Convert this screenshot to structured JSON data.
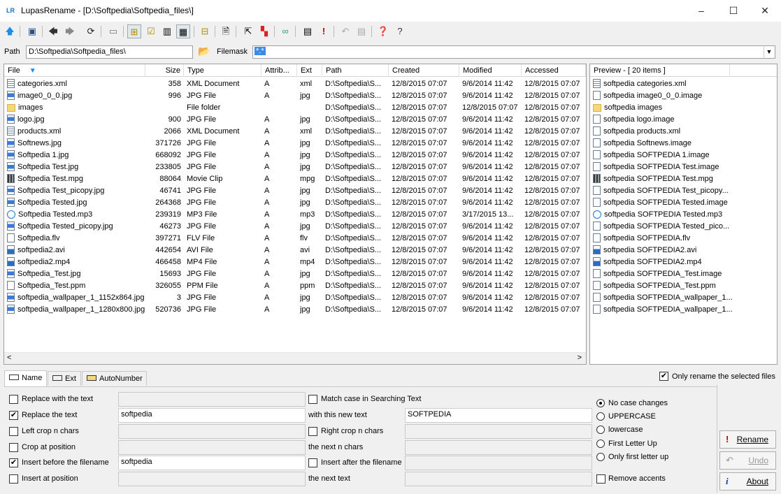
{
  "window": {
    "app_icon": "LR",
    "title": "LupasRename - [D:\\Softpedia\\Softpedia_files\\]",
    "minimize": "–",
    "maximize": "☐",
    "close": "✕"
  },
  "toolbar": {
    "icons": [
      "up-arrow-icon",
      "panel-icon",
      "back-icon",
      "forward-icon",
      "refresh-icon",
      "eraser-icon",
      "tree-icon",
      "check-list-icon",
      "columns-icon",
      "grid-icon",
      "folder-tree-icon",
      "document-icon",
      "export-icon",
      "color-icon",
      "glasses-icon",
      "batch-icon",
      "exclamation-icon",
      "undo-icon",
      "undo-batch-icon",
      "help-book-icon",
      "question-icon"
    ]
  },
  "pathbar": {
    "path_label": "Path",
    "path_value": "D:\\Softpedia\\Softpedia_files\\",
    "filemask_label": "Filemask",
    "filemask_value": "*.*"
  },
  "filelist": {
    "columns": [
      "File",
      "Size",
      "Type",
      "Attrib...",
      "Ext",
      "Path",
      "Created",
      "Modified",
      "Accessed"
    ],
    "rows": [
      {
        "icon": "xml",
        "name": "categories.xml",
        "size": "358",
        "type": "XML Document",
        "attrib": "A",
        "ext": "xml",
        "path": "D:\\Softpedia\\S...",
        "created": "12/8/2015 07:07",
        "modified": "9/6/2014 11:42",
        "accessed": "12/8/2015 07:07"
      },
      {
        "icon": "img",
        "name": "image0_0_0.jpg",
        "size": "996",
        "type": "JPG File",
        "attrib": "A",
        "ext": "jpg",
        "path": "D:\\Softpedia\\S...",
        "created": "12/8/2015 07:07",
        "modified": "9/6/2014 11:42",
        "accessed": "12/8/2015 07:07"
      },
      {
        "icon": "folder",
        "name": "images",
        "size": "",
        "type": "File folder",
        "attrib": "",
        "ext": "",
        "path": "D:\\Softpedia\\S...",
        "created": "12/8/2015 07:07",
        "modified": "12/8/2015 07:07",
        "accessed": "12/8/2015 07:07"
      },
      {
        "icon": "img",
        "name": "logo.jpg",
        "size": "900",
        "type": "JPG File",
        "attrib": "A",
        "ext": "jpg",
        "path": "D:\\Softpedia\\S...",
        "created": "12/8/2015 07:07",
        "modified": "9/6/2014 11:42",
        "accessed": "12/8/2015 07:07"
      },
      {
        "icon": "xml",
        "name": "products.xml",
        "size": "2066",
        "type": "XML Document",
        "attrib": "A",
        "ext": "xml",
        "path": "D:\\Softpedia\\S...",
        "created": "12/8/2015 07:07",
        "modified": "9/6/2014 11:42",
        "accessed": "12/8/2015 07:07"
      },
      {
        "icon": "img",
        "name": "Softnews.jpg",
        "size": "371726",
        "type": "JPG File",
        "attrib": "A",
        "ext": "jpg",
        "path": "D:\\Softpedia\\S...",
        "created": "12/8/2015 07:07",
        "modified": "9/6/2014 11:42",
        "accessed": "12/8/2015 07:07"
      },
      {
        "icon": "img",
        "name": "Softpedia 1.jpg",
        "size": "668092",
        "type": "JPG File",
        "attrib": "A",
        "ext": "jpg",
        "path": "D:\\Softpedia\\S...",
        "created": "12/8/2015 07:07",
        "modified": "9/6/2014 11:42",
        "accessed": "12/8/2015 07:07"
      },
      {
        "icon": "img",
        "name": "Softpedia Test.jpg",
        "size": "233805",
        "type": "JPG File",
        "attrib": "A",
        "ext": "jpg",
        "path": "D:\\Softpedia\\S...",
        "created": "12/8/2015 07:07",
        "modified": "9/6/2014 11:42",
        "accessed": "12/8/2015 07:07"
      },
      {
        "icon": "mov",
        "name": "Softpedia Test.mpg",
        "size": "88064",
        "type": "Movie Clip",
        "attrib": "A",
        "ext": "mpg",
        "path": "D:\\Softpedia\\S...",
        "created": "12/8/2015 07:07",
        "modified": "9/6/2014 11:42",
        "accessed": "12/8/2015 07:07"
      },
      {
        "icon": "img",
        "name": "Softpedia Test_picopy.jpg",
        "size": "46741",
        "type": "JPG File",
        "attrib": "A",
        "ext": "jpg",
        "path": "D:\\Softpedia\\S...",
        "created": "12/8/2015 07:07",
        "modified": "9/6/2014 11:42",
        "accessed": "12/8/2015 07:07"
      },
      {
        "icon": "img",
        "name": "Softpedia Tested.jpg",
        "size": "264368",
        "type": "JPG File",
        "attrib": "A",
        "ext": "jpg",
        "path": "D:\\Softpedia\\S...",
        "created": "12/8/2015 07:07",
        "modified": "9/6/2014 11:42",
        "accessed": "12/8/2015 07:07"
      },
      {
        "icon": "mp3",
        "name": "Softpedia Tested.mp3",
        "size": "239319",
        "type": "MP3 File",
        "attrib": "A",
        "ext": "mp3",
        "path": "D:\\Softpedia\\S...",
        "created": "12/8/2015 07:07",
        "modified": "3/17/2015 13...",
        "accessed": "12/8/2015 07:07"
      },
      {
        "icon": "img",
        "name": "Softpedia Tested_picopy.jpg",
        "size": "46273",
        "type": "JPG File",
        "attrib": "A",
        "ext": "jpg",
        "path": "D:\\Softpedia\\S...",
        "created": "12/8/2015 07:07",
        "modified": "9/6/2014 11:42",
        "accessed": "12/8/2015 07:07"
      },
      {
        "icon": "doc",
        "name": "Softpedia.flv",
        "size": "397271",
        "type": "FLV File",
        "attrib": "A",
        "ext": "flv",
        "path": "D:\\Softpedia\\S...",
        "created": "12/8/2015 07:07",
        "modified": "9/6/2014 11:42",
        "accessed": "12/8/2015 07:07"
      },
      {
        "icon": "vid",
        "name": "softpedia2.avi",
        "size": "442654",
        "type": "AVI File",
        "attrib": "A",
        "ext": "avi",
        "path": "D:\\Softpedia\\S...",
        "created": "12/8/2015 07:07",
        "modified": "9/6/2014 11:42",
        "accessed": "12/8/2015 07:07"
      },
      {
        "icon": "vid",
        "name": "softpedia2.mp4",
        "size": "466458",
        "type": "MP4 File",
        "attrib": "A",
        "ext": "mp4",
        "path": "D:\\Softpedia\\S...",
        "created": "12/8/2015 07:07",
        "modified": "9/6/2014 11:42",
        "accessed": "12/8/2015 07:07"
      },
      {
        "icon": "img",
        "name": "Softpedia_Test.jpg",
        "size": "15693",
        "type": "JPG File",
        "attrib": "A",
        "ext": "jpg",
        "path": "D:\\Softpedia\\S...",
        "created": "12/8/2015 07:07",
        "modified": "9/6/2014 11:42",
        "accessed": "12/8/2015 07:07"
      },
      {
        "icon": "doc",
        "name": "Softpedia_Test.ppm",
        "size": "326055",
        "type": "PPM File",
        "attrib": "A",
        "ext": "ppm",
        "path": "D:\\Softpedia\\S...",
        "created": "12/8/2015 07:07",
        "modified": "9/6/2014 11:42",
        "accessed": "12/8/2015 07:07"
      },
      {
        "icon": "img",
        "name": "softpedia_wallpaper_1_1152x864.jpg",
        "size": "3",
        "type": "JPG File",
        "attrib": "A",
        "ext": "jpg",
        "path": "D:\\Softpedia\\S...",
        "created": "12/8/2015 07:07",
        "modified": "9/6/2014 11:42",
        "accessed": "12/8/2015 07:07"
      },
      {
        "icon": "img",
        "name": "softpedia_wallpaper_1_1280x800.jpg",
        "size": "520736",
        "type": "JPG File",
        "attrib": "A",
        "ext": "jpg",
        "path": "D:\\Softpedia\\S...",
        "created": "12/8/2015 07:07",
        "modified": "9/6/2014 11:42",
        "accessed": "12/8/2015 07:07"
      }
    ],
    "scroll_left": "<",
    "scroll_right": ">"
  },
  "preview": {
    "header": "Preview - [ 20 items ]",
    "items": [
      {
        "icon": "xml",
        "name": "softpedia categories.xml"
      },
      {
        "icon": "doc",
        "name": "softpedia image0_0_0.image"
      },
      {
        "icon": "folder",
        "name": "softpedia images"
      },
      {
        "icon": "doc",
        "name": "softpedia logo.image"
      },
      {
        "icon": "doc",
        "name": "softpedia products.xml"
      },
      {
        "icon": "doc",
        "name": "softpedia Softnews.image"
      },
      {
        "icon": "doc",
        "name": "softpedia SOFTPEDIA 1.image"
      },
      {
        "icon": "doc",
        "name": "softpedia SOFTPEDIA Test.image"
      },
      {
        "icon": "mov",
        "name": "softpedia SOFTPEDIA Test.mpg"
      },
      {
        "icon": "doc",
        "name": "softpedia SOFTPEDIA Test_picopy..."
      },
      {
        "icon": "doc",
        "name": "softpedia SOFTPEDIA Tested.image"
      },
      {
        "icon": "mp3",
        "name": "softpedia SOFTPEDIA Tested.mp3"
      },
      {
        "icon": "doc",
        "name": "softpedia SOFTPEDIA Tested_pico..."
      },
      {
        "icon": "doc",
        "name": "softpedia SOFTPEDIA.flv"
      },
      {
        "icon": "vid",
        "name": "softpedia SOFTPEDIA2.avi"
      },
      {
        "icon": "vid",
        "name": "softpedia SOFTPEDIA2.mp4"
      },
      {
        "icon": "doc",
        "name": "softpedia SOFTPEDIA_Test.image"
      },
      {
        "icon": "doc",
        "name": "softpedia SOFTPEDIA_Test.ppm"
      },
      {
        "icon": "doc",
        "name": "softpedia SOFTPEDIA_wallpaper_1..."
      },
      {
        "icon": "doc",
        "name": "softpedia SOFTPEDIA_wallpaper_1..."
      }
    ]
  },
  "only_rename_selected": {
    "label": "Only rename the selected files",
    "checked": true
  },
  "tabs": [
    {
      "label": "Name",
      "icon": "name-tab-icon"
    },
    {
      "label": "Ext",
      "icon": "ext-tab-icon"
    },
    {
      "label": "AutoNumber",
      "icon": "autonumber-tab-icon"
    }
  ],
  "options": {
    "replace_with_text": {
      "label": "Replace with the text",
      "checked": false,
      "value": ""
    },
    "replace_the_text": {
      "label": "Replace the text",
      "checked": true,
      "value": "softpedia"
    },
    "left_crop": {
      "label": "Left crop n chars",
      "checked": false,
      "value": ""
    },
    "crop_at_position": {
      "label": "Crop at position",
      "checked": false,
      "value": ""
    },
    "insert_before": {
      "label": "Insert before the filename",
      "checked": true,
      "value": "softpedia"
    },
    "insert_at_position": {
      "label": "Insert at position",
      "checked": false,
      "value": ""
    },
    "match_case": {
      "label": "Match case  in Searching Text",
      "checked": false
    },
    "with_new_text": {
      "label": "with this new text",
      "value": "SOFTPEDIA"
    },
    "right_crop": {
      "label": "Right crop n chars",
      "checked": false,
      "value": ""
    },
    "next_n_chars": {
      "label": "the next n chars",
      "value": ""
    },
    "insert_after": {
      "label": "Insert after the filename",
      "checked": false,
      "value": ""
    },
    "next_text": {
      "label": "the next text",
      "value": ""
    }
  },
  "case_options": [
    {
      "label": "No case changes",
      "selected": true
    },
    {
      "label": "UPPERCASE",
      "selected": false
    },
    {
      "label": "lowercase",
      "selected": false
    },
    {
      "label": "First Letter Up",
      "selected": false
    },
    {
      "label": "Only first letter up",
      "selected": false
    }
  ],
  "remove_accents": {
    "label": "Remove accents",
    "checked": false
  },
  "buttons": {
    "rename": {
      "label": "Rename",
      "icon": "!"
    },
    "undo": {
      "label": "Undo",
      "icon": "↶"
    },
    "about": {
      "label": "About",
      "icon": "i"
    }
  }
}
